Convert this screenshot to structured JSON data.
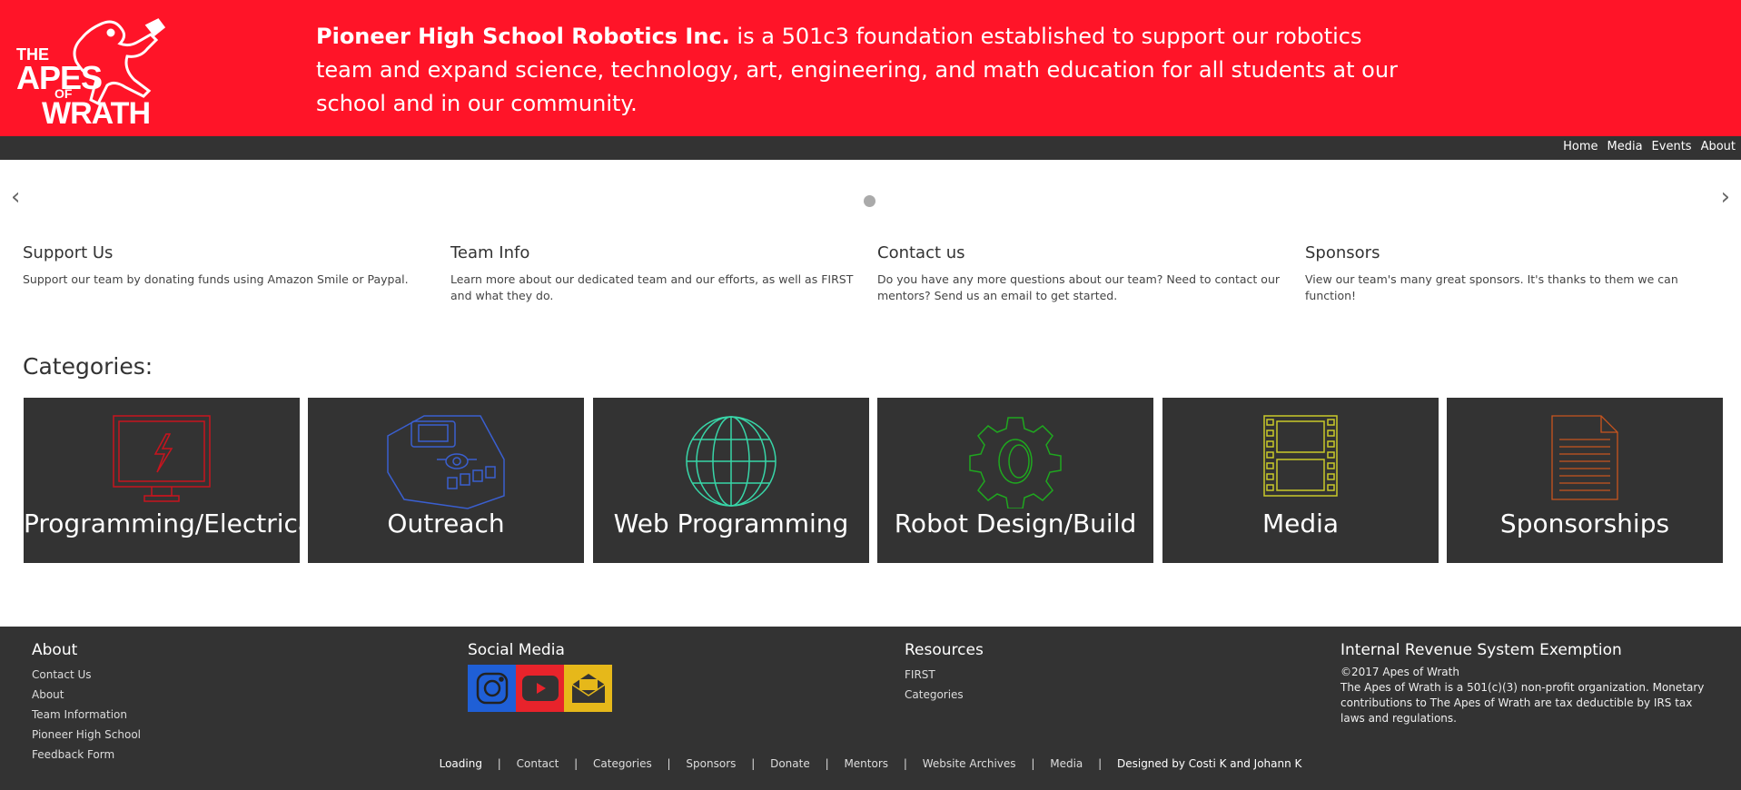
{
  "header": {
    "logo": {
      "line1": "THE",
      "line2": "APES",
      "line3": "OF",
      "line4": "WRATH"
    },
    "tagline_bold": "Pioneer High School Robotics Inc.",
    "tagline_rest": " is a 501c3 foundation established to support our robotics team and expand science, technology, art, engineering, and math education for all students at our school and in our community."
  },
  "nav": {
    "items": [
      "Home",
      "Media",
      "Events",
      "About"
    ]
  },
  "carousel": {
    "prev": "‹",
    "next": "›"
  },
  "infos": [
    {
      "title": "Support Us",
      "text": "Support our team by donating funds using Amazon Smile or Paypal."
    },
    {
      "title": "Team Info",
      "text": "Learn more about our dedicated team and our efforts, as well as FIRST and what they do."
    },
    {
      "title": "Contact us",
      "text": "Do you have any more questions about our team? Need to contact our mentors? Send us an email to get started."
    },
    {
      "title": "Sponsors",
      "text": "View our team's many great sponsors. It's thanks to them we can function!"
    }
  ],
  "categories": {
    "heading": "Categories:",
    "tiles": [
      {
        "label": "Programming/Electrical",
        "icon": "monitor-lightning-icon",
        "color": "#c8141e"
      },
      {
        "label": "Outreach",
        "icon": "robot-brick-icon",
        "color": "#3a5fd0"
      },
      {
        "label": "Web Programming",
        "icon": "globe-icon",
        "color": "#38d6a8"
      },
      {
        "label": "Robot Design/Build",
        "icon": "gear-icon",
        "color": "#1fa81f"
      },
      {
        "label": "Media",
        "icon": "film-strip-icon",
        "color": "#c9c92a"
      },
      {
        "label": "Sponsorships",
        "icon": "document-icon",
        "color": "#c8541e"
      }
    ]
  },
  "footer": {
    "about": {
      "title": "About",
      "links": [
        "Contact Us",
        "About",
        "Team Information",
        "Pioneer High School",
        "Feedback Form"
      ]
    },
    "social": {
      "title": "Social Media",
      "icons": [
        "instagram-icon",
        "youtube-icon",
        "email-icon"
      ],
      "colors": [
        "#1f5fd6",
        "#e8232b",
        "#e6b81a"
      ]
    },
    "resources": {
      "title": "Resources",
      "links": [
        "FIRST",
        "Categories"
      ]
    },
    "irs": {
      "title": "Internal Revenue System Exemption",
      "copyright": "©2017 Apes of Wrath",
      "text": "The Apes of Wrath is a 501(c)(3) non-profit organization. Monetary contributions to The Apes of Wrath are tax deductible by IRS tax laws and regulations."
    },
    "bottom": {
      "loading": "Loading",
      "links": [
        "Contact",
        "Categories",
        "Sponsors",
        "Donate",
        "Mentors",
        "Website Archives",
        "Media"
      ],
      "credit": "Designed by Costi K and Johann K"
    }
  }
}
